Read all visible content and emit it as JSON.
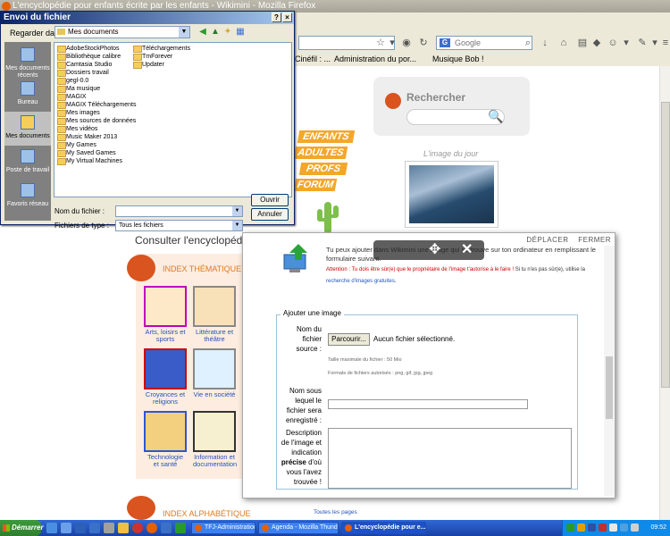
{
  "firefox": {
    "title": "L'encyclopédie pour enfants écrite par les enfants - Wikimini - Mozilla Firefox",
    "search_placeholder": "Google",
    "bookmarks": [
      "Cinéfil : ...",
      "Administration du por...",
      "Musique Bob !"
    ]
  },
  "page": {
    "search_title": "Rechercher",
    "image_of_day": "L'image du jour",
    "consult": "Consulter l'encyclopédie",
    "index_thematique": "INDEX THÉMATIQUE",
    "index_alphabetique": "INDEX ALPHABÉTIQUE",
    "all_pages": "Toutes les pages",
    "sign_boards": [
      "ENFANTS",
      "ADULTES",
      "PROFS",
      "FORUM"
    ],
    "categories": [
      {
        "label": "Arts, loisirs et sports"
      },
      {
        "label": "Littérature et théâtre"
      },
      {
        "label": "Croyances et religions"
      },
      {
        "label": "Vie en société"
      },
      {
        "label": "Technologie et santé"
      },
      {
        "label": "Information et documentation"
      }
    ]
  },
  "dialog": {
    "title": "Envoi du fichier",
    "look_in_label": "Regarder dans :",
    "look_in_value": "Mes documents",
    "places": [
      "Mes documents récents",
      "Bureau",
      "Mes documents",
      "Poste de travail",
      "Favoris réseau"
    ],
    "files_col1": [
      "AdobeStockPhotos",
      "Bibliothèque calibre",
      "Camtasia Studio",
      "Dossiers travail",
      "gegl-0.0",
      "Ma musique",
      "MAGIX",
      "MAGIX Téléchargements",
      "Mes images",
      "Mes sources de données",
      "Mes vidéos",
      "Music Maker 2013",
      "My Games",
      "My Saved Games",
      "My Virtual Machines"
    ],
    "files_col2": [
      "Téléchargements",
      "TmForever",
      "Updater"
    ],
    "filename_label": "Nom du fichier :",
    "filetype_label": "Fichiers de type :",
    "filetype_value": "Tous les fichiers",
    "open_button": "Ouvrir",
    "cancel_button": "Annuler"
  },
  "modal": {
    "move": "DÉPLACER",
    "close": "FERMER",
    "intro": "Tu peux ajouter dans Wikimini une image qui se trouve sur ton ordinateur en remplissant le formulaire suivant.",
    "warning": "Attention : Tu dois être sûr(e) que le propriétaire de l'image t'autorise à le faire !",
    "warning_tail": " Si tu n'es pas sûr(e), utilise la ",
    "warning_link": "recherche d'images gratuites",
    "warning_end": ".",
    "legend": "Ajouter une image",
    "file_label": "Nom du fichier source :",
    "browse_button": "Parcourir...",
    "no_file": "Aucun fichier sélectionné.",
    "max_size": "Taille maximale du fichier : 50 Mio",
    "formats": "Formats de fichiers autorisés : png, gif, jpg, jpeg",
    "name_label": "Nom sous lequel le fichier sera enregistré :",
    "desc_label_1": "Description de l'image et indication",
    "desc_label_bold": "précise",
    "desc_label_2": "d'où vous l'avez trouvée !"
  },
  "taskbar": {
    "start": "Démarrer",
    "tasks": [
      "TFJ-Administration",
      "Agenda - Mozilla Thunde...",
      "L'encyclopédie pour e..."
    ],
    "clock": "09:52"
  }
}
